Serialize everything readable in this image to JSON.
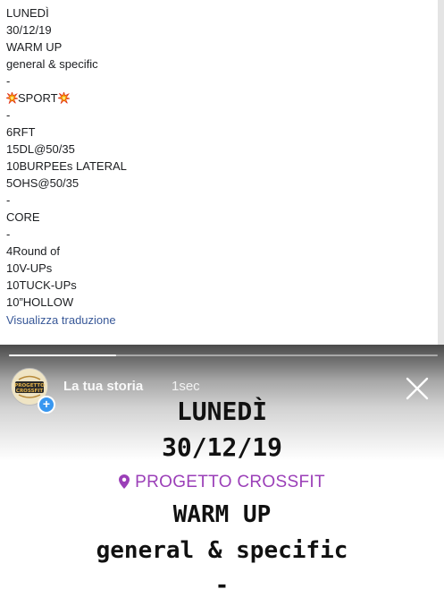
{
  "post": {
    "lines": [
      "LUNEDÌ",
      "30/12/19",
      "WARM UP",
      "general & specific",
      "-",
      "SPORT",
      "-",
      "6RFT",
      "15DL@50/35",
      "10BURPEEs LATERAL",
      "5OHS@50/35",
      "-",
      "CORE",
      "-",
      "4Round of",
      "10V-UPs",
      "10TUCK-UPs",
      "10”HOLLOW"
    ],
    "translate_link": "Visualizza traduzione"
  },
  "story": {
    "progress": 0.25,
    "user": "La tua storia",
    "time": "1sec",
    "avatar_text_top": "PROGETTO",
    "avatar_text_bottom": "CROSSFIT",
    "add_badge": "+",
    "day": "LUNEDÌ",
    "date": "30/12/19",
    "location": "PROGETTO CROSSFIT",
    "warm": "WARM UP",
    "general": "general & specific",
    "dash": "-"
  },
  "colors": {
    "link": "#385898",
    "location": "#9b3fb8",
    "badge": "#3897f0"
  }
}
